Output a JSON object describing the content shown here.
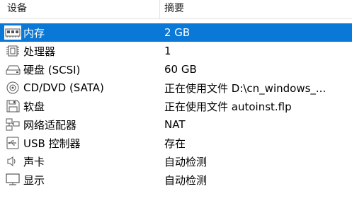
{
  "header": {
    "device_col": "设备",
    "summary_col": "摘要"
  },
  "rows": [
    {
      "icon": "memory-icon",
      "device": "内存",
      "summary": "2 GB",
      "selected": true
    },
    {
      "icon": "processor-icon",
      "device": "处理器",
      "summary": "1",
      "selected": false
    },
    {
      "icon": "hard-disk-icon",
      "device": "硬盘 (SCSI)",
      "summary": "60 GB",
      "selected": false
    },
    {
      "icon": "cd-dvd-icon",
      "device": "CD/DVD (SATA)",
      "summary": "正在使用文件 D:\\cn_windows_...",
      "selected": false
    },
    {
      "icon": "floppy-icon",
      "device": "软盘",
      "summary": "正在使用文件 autoinst.flp",
      "selected": false
    },
    {
      "icon": "network-adapter-icon",
      "device": "网络适配器",
      "summary": "NAT",
      "selected": false
    },
    {
      "icon": "usb-icon",
      "device": "USB 控制器",
      "summary": "存在",
      "selected": false
    },
    {
      "icon": "sound-card-icon",
      "device": "声卡",
      "summary": "自动检测",
      "selected": false
    },
    {
      "icon": "display-icon",
      "device": "显示",
      "summary": "自动检测",
      "selected": false
    }
  ],
  "colors": {
    "selection": "#0a78d7",
    "selection_text": "#ffffff",
    "text": "#000000"
  }
}
